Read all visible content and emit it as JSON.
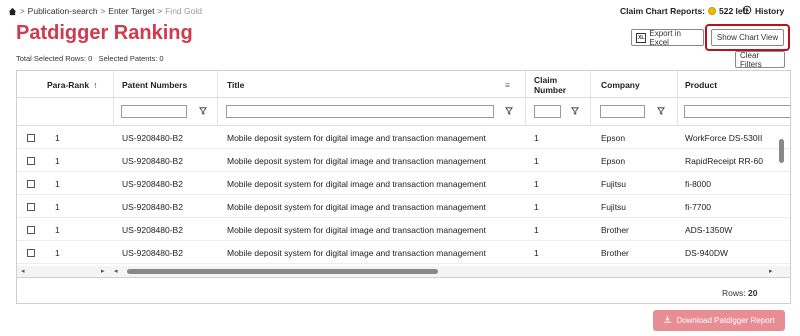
{
  "breadcrumb": {
    "items": [
      "Publication-search",
      "Enter Target",
      "Find Gold"
    ]
  },
  "header": {
    "reports_label": "Claim Chart Reports:",
    "reports_left": "522 left",
    "history_label": "History"
  },
  "page": {
    "title": "Patdigger Ranking",
    "total_selected_rows": "Total Selected Rows: 0",
    "selected_patents": "Selected Patents: 0"
  },
  "toolbar": {
    "export_label": "Export in Excel",
    "chart_view_label": "Show Chart View",
    "clear_filters_label": "Clear Filters"
  },
  "table": {
    "columns": {
      "para_rank": "Para-Rank",
      "patent_numbers": "Patent Numbers",
      "title": "Title",
      "claim_number": "Claim Number",
      "company": "Company",
      "product": "Product"
    },
    "rows": [
      {
        "rank": "1",
        "patent": "US-9208480-B2",
        "title": "Mobile deposit system for digital image and transaction management",
        "claim": "1",
        "company": "Epson",
        "product": "WorkForce DS-530II"
      },
      {
        "rank": "1",
        "patent": "US-9208480-B2",
        "title": "Mobile deposit system for digital image and transaction management",
        "claim": "1",
        "company": "Epson",
        "product": "RapidReceipt RR-60"
      },
      {
        "rank": "1",
        "patent": "US-9208480-B2",
        "title": "Mobile deposit system for digital image and transaction management",
        "claim": "1",
        "company": "Fujitsu",
        "product": "fi-8000"
      },
      {
        "rank": "1",
        "patent": "US-9208480-B2",
        "title": "Mobile deposit system for digital image and transaction management",
        "claim": "1",
        "company": "Fujitsu",
        "product": "fi-7700"
      },
      {
        "rank": "1",
        "patent": "US-9208480-B2",
        "title": "Mobile deposit system for digital image and transaction management",
        "claim": "1",
        "company": "Brother",
        "product": "ADS-1350W"
      },
      {
        "rank": "1",
        "patent": "US-9208480-B2",
        "title": "Mobile deposit system for digital image and transaction management",
        "claim": "1",
        "company": "Brother",
        "product": "DS-940DW"
      }
    ],
    "rows_label": "Rows:",
    "rows_count": "20"
  },
  "footer": {
    "download_label": "Download Patdigger Report"
  },
  "colors": {
    "accent": "#d13a4c",
    "highlight": "#b5141e",
    "download": "#e98d95"
  }
}
